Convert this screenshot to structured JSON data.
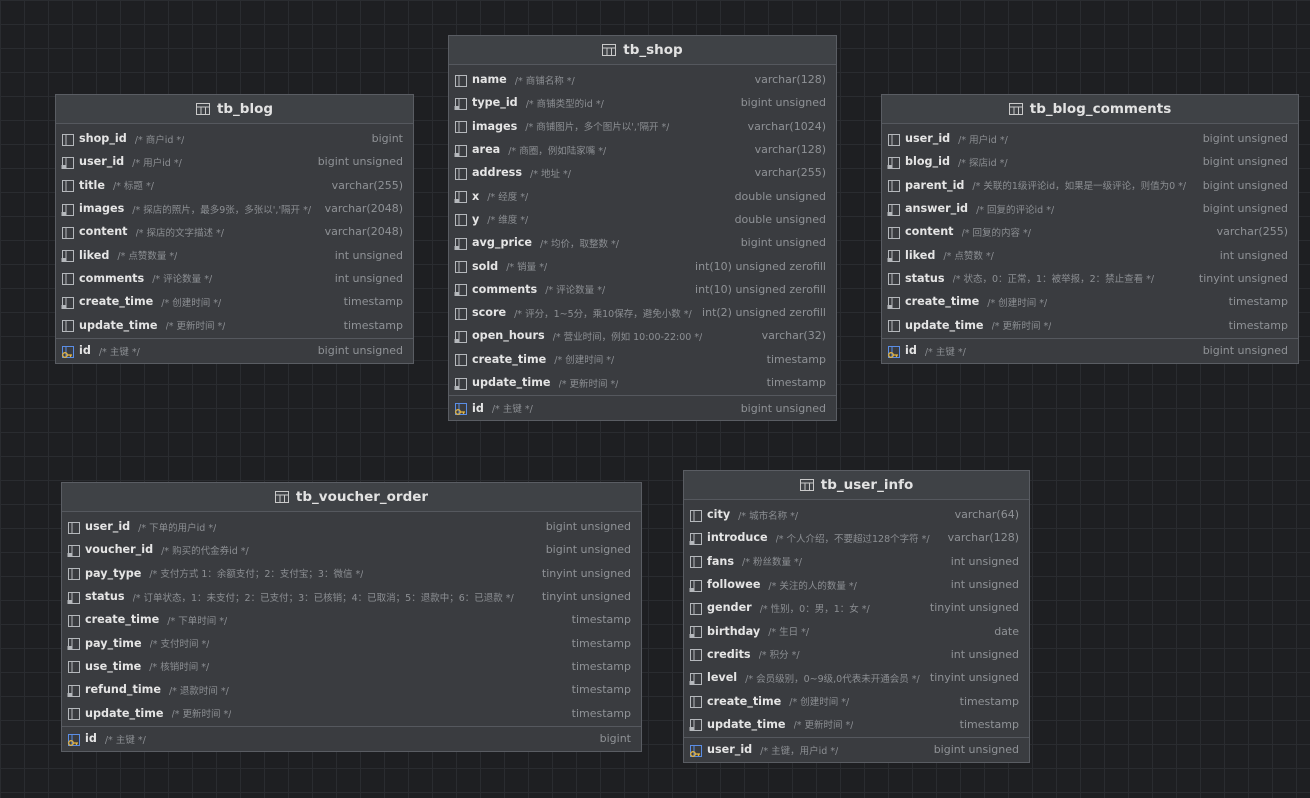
{
  "tables": [
    {
      "name": "tb_shop",
      "fields": [
        {
          "name": "name",
          "comment": "/* 商铺名称 */",
          "type": "varchar(128)"
        },
        {
          "name": "type_id",
          "comment": "/* 商铺类型的id */",
          "type": "bigint unsigned"
        },
        {
          "name": "images",
          "comment": "/* 商铺图片，多个图片以','隔开 */",
          "type": "varchar(1024)"
        },
        {
          "name": "area",
          "comment": "/* 商圈，例如陆家嘴 */",
          "type": "varchar(128)"
        },
        {
          "name": "address",
          "comment": "/* 地址 */",
          "type": "varchar(255)"
        },
        {
          "name": "x",
          "comment": "/* 经度 */",
          "type": "double unsigned"
        },
        {
          "name": "y",
          "comment": "/* 维度 */",
          "type": "double unsigned"
        },
        {
          "name": "avg_price",
          "comment": "/* 均价，取整数 */",
          "type": "bigint unsigned"
        },
        {
          "name": "sold",
          "comment": "/* 销量 */",
          "type": "int(10) unsigned zerofill"
        },
        {
          "name": "comments",
          "comment": "/* 评论数量 */",
          "type": "int(10) unsigned zerofill"
        },
        {
          "name": "score",
          "comment": "/* 评分，1~5分，乘10保存，避免小数 */",
          "type": "int(2) unsigned zerofill"
        },
        {
          "name": "open_hours",
          "comment": "/* 营业时间，例如 10:00-22:00 */",
          "type": "varchar(32)"
        },
        {
          "name": "create_time",
          "comment": "/* 创建时间 */",
          "type": "timestamp"
        },
        {
          "name": "update_time",
          "comment": "/* 更新时间 */",
          "type": "timestamp"
        }
      ],
      "pk": {
        "name": "id",
        "comment": "/* 主键 */",
        "type": "bigint unsigned"
      }
    },
    {
      "name": "tb_blog",
      "fields": [
        {
          "name": "shop_id",
          "comment": "/* 商户id */",
          "type": "bigint"
        },
        {
          "name": "user_id",
          "comment": "/* 用户id */",
          "type": "bigint unsigned"
        },
        {
          "name": "title",
          "comment": "/* 标题 */",
          "type": "varchar(255)"
        },
        {
          "name": "images",
          "comment": "/* 探店的照片，最多9张，多张以','隔开 */",
          "type": "varchar(2048)"
        },
        {
          "name": "content",
          "comment": "/* 探店的文字描述 */",
          "type": "varchar(2048)"
        },
        {
          "name": "liked",
          "comment": "/* 点赞数量 */",
          "type": "int unsigned"
        },
        {
          "name": "comments",
          "comment": "/* 评论数量 */",
          "type": "int unsigned"
        },
        {
          "name": "create_time",
          "comment": "/* 创建时间 */",
          "type": "timestamp"
        },
        {
          "name": "update_time",
          "comment": "/* 更新时间 */",
          "type": "timestamp"
        }
      ],
      "pk": {
        "name": "id",
        "comment": "/* 主键 */",
        "type": "bigint unsigned"
      }
    },
    {
      "name": "tb_blog_comments",
      "fields": [
        {
          "name": "user_id",
          "comment": "/* 用户id */",
          "type": "bigint unsigned"
        },
        {
          "name": "blog_id",
          "comment": "/* 探店id */",
          "type": "bigint unsigned"
        },
        {
          "name": "parent_id",
          "comment": "/* 关联的1级评论id，如果是一级评论，则值为0 */",
          "type": "bigint unsigned"
        },
        {
          "name": "answer_id",
          "comment": "/* 回复的评论id */",
          "type": "bigint unsigned"
        },
        {
          "name": "content",
          "comment": "/* 回复的内容 */",
          "type": "varchar(255)"
        },
        {
          "name": "liked",
          "comment": "/* 点赞数 */",
          "type": "int unsigned"
        },
        {
          "name": "status",
          "comment": "/* 状态，0：正常，1：被举报，2：禁止查看 */",
          "type": "tinyint unsigned"
        },
        {
          "name": "create_time",
          "comment": "/* 创建时间 */",
          "type": "timestamp"
        },
        {
          "name": "update_time",
          "comment": "/* 更新时间 */",
          "type": "timestamp"
        }
      ],
      "pk": {
        "name": "id",
        "comment": "/* 主键 */",
        "type": "bigint unsigned"
      }
    },
    {
      "name": "tb_voucher_order",
      "fields": [
        {
          "name": "user_id",
          "comment": "/* 下单的用户id */",
          "type": "bigint unsigned"
        },
        {
          "name": "voucher_id",
          "comment": "/* 购买的代金券id */",
          "type": "bigint unsigned"
        },
        {
          "name": "pay_type",
          "comment": "/* 支付方式 1：余额支付；2：支付宝；3：微信 */",
          "type": "tinyint unsigned"
        },
        {
          "name": "status",
          "comment": "/* 订单状态，1：未支付；2：已支付；3：已核销；4：已取消；5：退款中；6：已退款 */",
          "type": "tinyint unsigned"
        },
        {
          "name": "create_time",
          "comment": "/* 下单时间 */",
          "type": "timestamp"
        },
        {
          "name": "pay_time",
          "comment": "/* 支付时间 */",
          "type": "timestamp"
        },
        {
          "name": "use_time",
          "comment": "/* 核销时间 */",
          "type": "timestamp"
        },
        {
          "name": "refund_time",
          "comment": "/* 退款时间 */",
          "type": "timestamp"
        },
        {
          "name": "update_time",
          "comment": "/* 更新时间 */",
          "type": "timestamp"
        }
      ],
      "pk": {
        "name": "id",
        "comment": "/* 主键 */",
        "type": "bigint"
      }
    },
    {
      "name": "tb_user_info",
      "fields": [
        {
          "name": "city",
          "comment": "/* 城市名称 */",
          "type": "varchar(64)"
        },
        {
          "name": "introduce",
          "comment": "/* 个人介绍，不要超过128个字符 */",
          "type": "varchar(128)"
        },
        {
          "name": "fans",
          "comment": "/* 粉丝数量 */",
          "type": "int unsigned"
        },
        {
          "name": "followee",
          "comment": "/* 关注的人的数量 */",
          "type": "int unsigned"
        },
        {
          "name": "gender",
          "comment": "/* 性别，0：男，1：女 */",
          "type": "tinyint unsigned"
        },
        {
          "name": "birthday",
          "comment": "/* 生日 */",
          "type": "date"
        },
        {
          "name": "credits",
          "comment": "/* 积分 */",
          "type": "int unsigned"
        },
        {
          "name": "level",
          "comment": "/* 会员级别，0~9级,0代表未开通会员 */",
          "type": "tinyint unsigned"
        },
        {
          "name": "create_time",
          "comment": "/* 创建时间 */",
          "type": "timestamp"
        },
        {
          "name": "update_time",
          "comment": "/* 更新时间 */",
          "type": "timestamp"
        }
      ],
      "pk": {
        "name": "user_id",
        "comment": "/* 主键，用户id */",
        "type": "bigint unsigned"
      }
    }
  ]
}
